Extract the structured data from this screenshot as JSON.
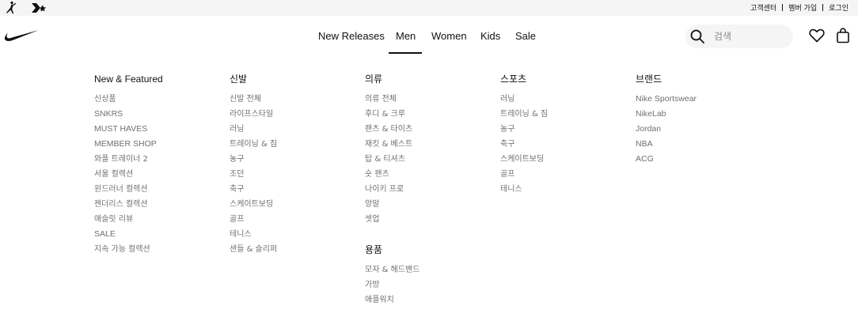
{
  "topbar": {
    "brands": [
      {
        "icon": "jordan-jumpman-icon"
      },
      {
        "icon": "converse-logo-icon"
      }
    ],
    "links": [
      "고객센터",
      "멤버 가입",
      "로그인"
    ]
  },
  "header": {
    "logo_icon": "nike-swoosh-icon",
    "nav": [
      "New Releases",
      "Men",
      "Women",
      "Kids",
      "Sale"
    ],
    "active_nav": "Men",
    "search": {
      "placeholder": "검색",
      "value": "",
      "icon": "search-icon"
    },
    "icons": [
      "heart-icon",
      "bag-icon"
    ]
  },
  "menu": {
    "featured": {
      "title": "New & Featured",
      "items": [
        "신상품",
        "SNKRS",
        "MUST HAVES",
        "MEMBER SHOP",
        "와플 트레이너 2",
        "서울 컬렉션",
        "윈드러너 컬렉션",
        "젠더리스 컬렉션",
        "애슬릿 리뷰",
        "SALE",
        "지속 가능 컬렉션"
      ]
    },
    "shoes": {
      "title": "신발",
      "items": [
        "신발 전체",
        "라이프스타일",
        "러닝",
        "트레이닝 & 짐",
        "농구",
        "조던",
        "축구",
        "스케이트보딩",
        "골프",
        "테니스",
        "샌들 & 슬리퍼"
      ]
    },
    "clothing": {
      "title": "의류",
      "items": [
        "의류 전체",
        "후디 & 크루",
        "팬츠 & 타이츠",
        "재킷 & 베스트",
        "탑 & 티셔츠",
        "숏 팬츠",
        "나이키 프로",
        "양말",
        "셋업"
      ]
    },
    "accessories": {
      "title": "용품",
      "items": [
        "모자 & 헤드밴드",
        "가방",
        "애플워치"
      ]
    },
    "sports": {
      "title": "스포츠",
      "items": [
        "러닝",
        "트레이닝 & 짐",
        "농구",
        "축구",
        "스케이트보딩",
        "골프",
        "테니스"
      ]
    },
    "brands": {
      "title": "브랜드",
      "items": [
        "Nike Sportswear",
        "NikeLab",
        "Jordan",
        "NBA",
        "ACG"
      ]
    }
  }
}
